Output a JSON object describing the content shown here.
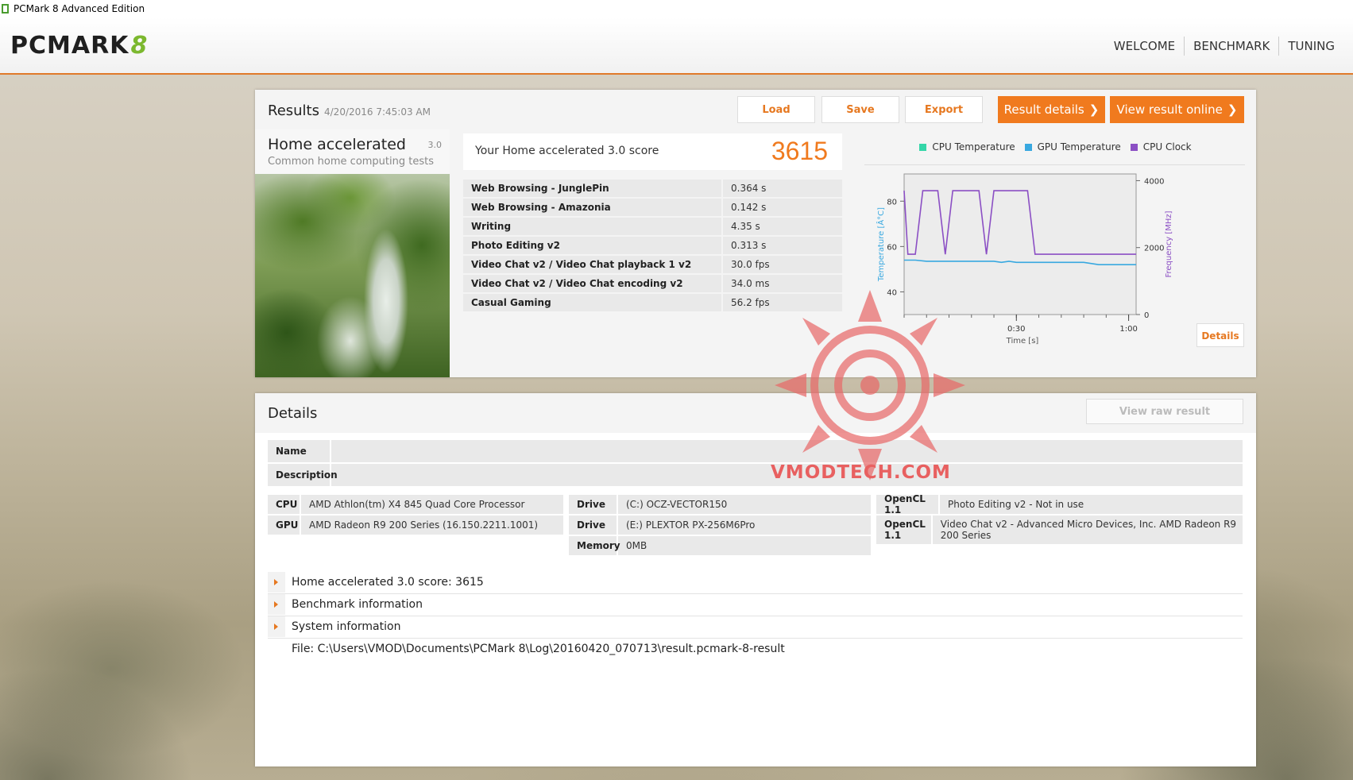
{
  "window": {
    "title": "PCMark 8 Advanced Edition"
  },
  "header": {
    "logo": "PCMARK",
    "logo_version": "8",
    "nav": [
      "WELCOME",
      "BENCHMARK",
      "TUNING"
    ]
  },
  "results": {
    "title": "Results",
    "date": "4/20/2016 7:45:03 AM",
    "buttons": {
      "load": "Load",
      "save": "Save",
      "export": "Export",
      "result_details": "Result details",
      "view_online": "View result online"
    },
    "test": {
      "name": "Home accelerated",
      "version": "3.0",
      "description": "Common home computing tests"
    },
    "score_label": "Your Home accelerated 3.0 score",
    "score": "3615",
    "rows": [
      {
        "name": "Web Browsing - JunglePin",
        "value": "0.364 s"
      },
      {
        "name": "Web Browsing - Amazonia",
        "value": "0.142 s"
      },
      {
        "name": "Writing",
        "value": "4.35 s"
      },
      {
        "name": "Photo Editing v2",
        "value": "0.313 s"
      },
      {
        "name": "Video Chat v2 / Video Chat playback 1 v2",
        "value": "30.0 fps"
      },
      {
        "name": "Video Chat v2 / Video Chat encoding v2",
        "value": "34.0 ms"
      },
      {
        "name": "Casual Gaming",
        "value": "56.2 fps"
      }
    ],
    "details_button": "Details"
  },
  "chart_data": {
    "type": "line",
    "legend": [
      {
        "name": "CPU Temperature",
        "color": "#34d6a8"
      },
      {
        "name": "GPU Temperature",
        "color": "#38a8e0"
      },
      {
        "name": "CPU Clock",
        "color": "#8b4fc4"
      }
    ],
    "xlabel": "Time [s]",
    "ylabel_left": "Temperature [Â°C]",
    "ylabel_right": "Frequency [MHz]",
    "x_ticks": [
      "0:30",
      "1:00"
    ],
    "y_left_ticks": [
      "40",
      "60",
      "80"
    ],
    "y_right_ticks": [
      "0",
      "2000",
      "4000"
    ],
    "xlim": [
      0,
      62
    ],
    "ylim_left": [
      30,
      92
    ],
    "ylim_right": [
      0,
      4200
    ],
    "series": [
      {
        "name": "GPU Temperature",
        "axis": "left",
        "x": [
          0,
          3,
          6,
          12,
          24,
          26,
          28,
          30,
          40,
          48,
          52,
          62
        ],
        "y": [
          54,
          54,
          53.5,
          53.5,
          53.5,
          53,
          53.5,
          53,
          53,
          53,
          52,
          52
        ]
      },
      {
        "name": "CPU Clock",
        "axis": "right",
        "x": [
          0,
          1,
          3,
          5,
          7,
          9,
          11,
          13,
          15,
          17,
          20,
          22,
          24,
          26,
          28,
          31,
          33,
          35,
          37,
          47,
          48,
          62
        ],
        "y": [
          3700,
          1800,
          1800,
          3700,
          3700,
          3700,
          1800,
          3700,
          3700,
          3700,
          3700,
          1800,
          3700,
          3700,
          3700,
          3700,
          3700,
          1800,
          1800,
          1800,
          1800,
          1800
        ]
      }
    ]
  },
  "details": {
    "title": "Details",
    "raw_button": "View raw result",
    "name_label": "Name",
    "description_label": "Description",
    "sys_left": [
      {
        "k": "CPU",
        "v": "AMD Athlon(tm) X4 845 Quad Core Processor"
      },
      {
        "k": "GPU",
        "v": "AMD Radeon R9 200 Series (16.150.2211.1001)"
      }
    ],
    "sys_mid": [
      {
        "k": "Drive",
        "v": "(C:) OCZ-VECTOR150"
      },
      {
        "k": "Drive",
        "v": "(E:) PLEXTOR PX-256M6Pro"
      },
      {
        "k": "Memory",
        "v": "0MB"
      }
    ],
    "sys_right": [
      {
        "k": "OpenCL 1.1",
        "v": "Photo Editing v2 - Not in use"
      },
      {
        "k": "OpenCL 1.1",
        "v": "Video Chat v2 - Advanced Micro Devices, Inc. AMD Radeon R9 200 Series"
      }
    ],
    "expand": [
      "Home accelerated 3.0 score: 3615",
      "Benchmark information",
      "System information"
    ],
    "file": "File: C:\\Users\\VMOD\\Documents\\PCMark 8\\Log\\20160420_070713\\result.pcmark-8-result"
  },
  "watermark": "VMODTECH.COM"
}
